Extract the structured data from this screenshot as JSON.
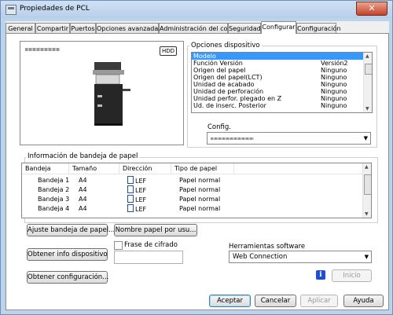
{
  "window": {
    "title": "Propiedades de PCL",
    "close": "✕"
  },
  "tabs": [
    {
      "label": "General"
    },
    {
      "label": "Compartir"
    },
    {
      "label": "Puertos"
    },
    {
      "label": "Opciones avanzadas"
    },
    {
      "label": "Administración del color"
    },
    {
      "label": "Seguridad"
    },
    {
      "label": "Configurar"
    },
    {
      "label": "Configuración"
    }
  ],
  "preview": {
    "hdd_badge": "HDD"
  },
  "device_options": {
    "label": "Opciones dispositivo",
    "items": [
      {
        "name": "Modelo",
        "value": ""
      },
      {
        "name": "Función Versión",
        "value": "Versión2"
      },
      {
        "name": "Origen del papel",
        "value": "Ninguno"
      },
      {
        "name": "Origen del papel(LCT)",
        "value": "Ninguno"
      },
      {
        "name": "Unidad de acabado",
        "value": "Ninguno"
      },
      {
        "name": "Unidad de perforación",
        "value": "Ninguno"
      },
      {
        "name": "Unidad perfor. plegado en Z",
        "value": "Ninguno"
      },
      {
        "name": "Ud. de inserc. Posterior",
        "value": "Ninguno"
      }
    ],
    "config_label": "Config."
  },
  "tray_info": {
    "label": "Información de bandeja de papel",
    "headers": [
      "Bandeja",
      "Tamaño",
      "Dirección",
      "Tipo de papel"
    ],
    "rows": [
      {
        "tray": "Bandeja 1",
        "size": "A4",
        "direction": "LEF",
        "type": "Papel normal"
      },
      {
        "tray": "Bandeja 2",
        "size": "A4",
        "direction": "LEF",
        "type": "Papel normal"
      },
      {
        "tray": "Bandeja 3",
        "size": "A4",
        "direction": "LEF",
        "type": "Papel normal"
      },
      {
        "tray": "Bandeja 4",
        "size": "A4",
        "direction": "LEF",
        "type": "Papel normal"
      }
    ],
    "adjust_button": "Ajuste bandeja de papel...",
    "paper_name_button": "Nombre papel por usu..."
  },
  "device_info_button": "Obtener info dispositivo",
  "encryption": {
    "label": "Frase de cifrado",
    "value": ""
  },
  "software": {
    "label": "Herramientas software",
    "selected": "Web Connection",
    "start_button": "Inicio"
  },
  "get_config_button": "Obtener configuración...",
  "footer": {
    "ok": "Aceptar",
    "cancel": "Cancelar",
    "apply": "Aplicar",
    "help": "Ayuda"
  }
}
